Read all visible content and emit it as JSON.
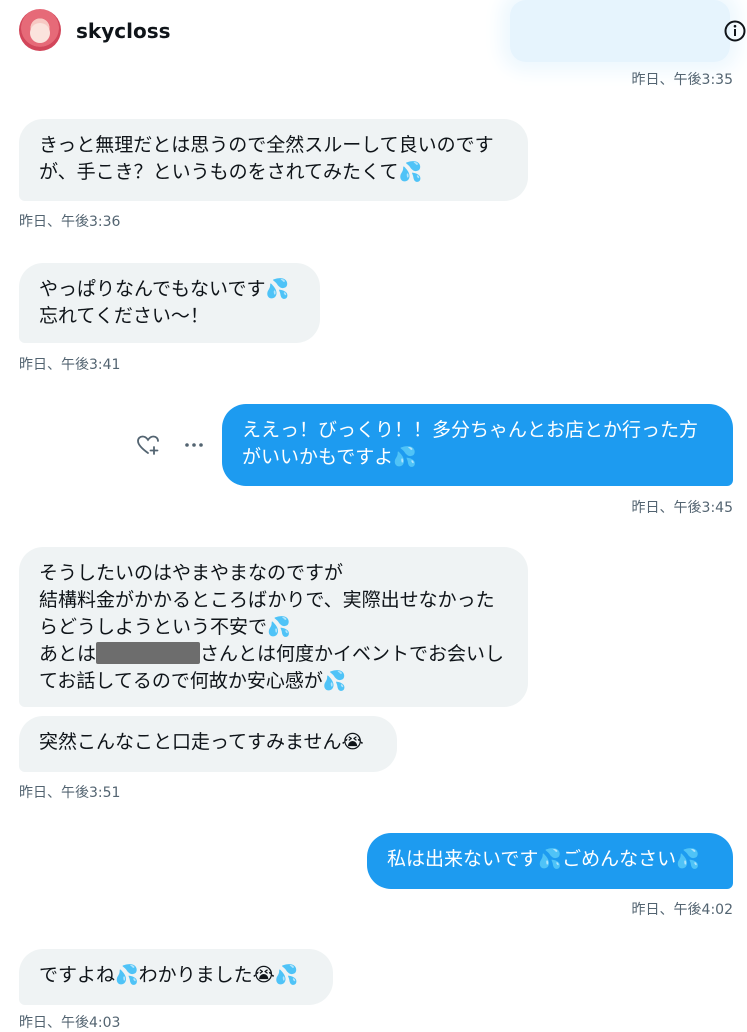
{
  "header": {
    "username": "skycloss"
  },
  "messages": [
    {
      "dir": "in",
      "text": "きっと無理だとは思うので全然スルーして良いのですが、手こき？というものをされてみたくて💦"
    },
    {
      "dir": "in",
      "text": "やっぱりなんでもないです💦\n忘れてください〜！"
    },
    {
      "dir": "out",
      "text": "ええっ！びっくり！！多分ちゃんとお店とか行った方がいいかもですよ💦"
    },
    {
      "dir": "in",
      "text_part1": "そうしたいのはやまやまなのですが\n結構料金がかかるところばかりで、実際出せなかったらどうしようという不安で💦\nあとは",
      "text_part2": "さんとは何度かイベントでお会いしてお話してるので何故か安心感が💦"
    },
    {
      "dir": "in",
      "text": "突然こんなこと口走ってすみません😭"
    },
    {
      "dir": "out",
      "text": "私は出来ないです💦ごめんなさい💦"
    },
    {
      "dir": "in",
      "text": "ですよね💦わかりました😭💦"
    }
  ],
  "timestamps": {
    "t0": "昨日、午後3:35",
    "t1": "昨日、午後3:36",
    "t2": "昨日、午後3:41",
    "t3": "昨日、午後3:45",
    "t4": "昨日、午後3:51",
    "t5": "昨日、午後4:02",
    "t6": "昨日、午後4:03"
  },
  "icons": {
    "info": "info-icon",
    "react": "heart-plus-icon",
    "more": "more-icon"
  },
  "colors": {
    "outgoing_bubble": "#1d9bf0",
    "incoming_bubble": "#eff3f4",
    "timestamp": "#536471"
  }
}
